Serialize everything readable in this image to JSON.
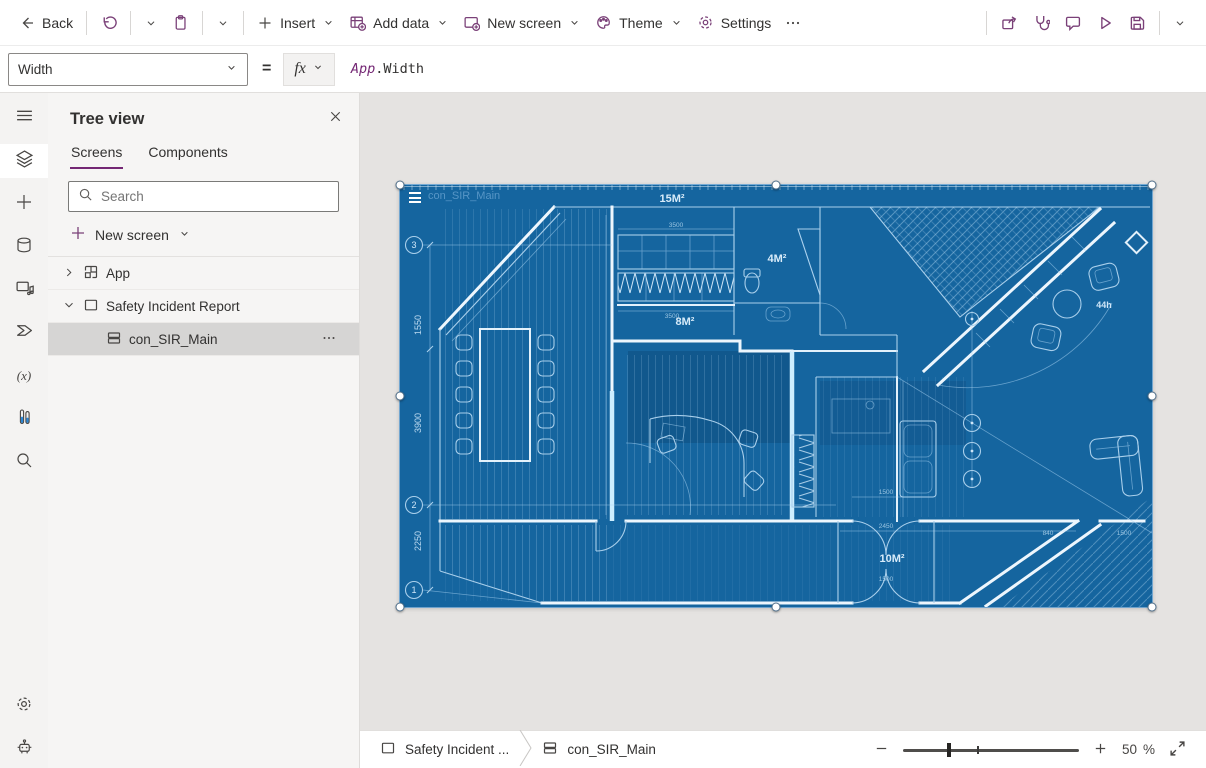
{
  "toolbar": {
    "back_label": "Back",
    "insert_label": "Insert",
    "add_data_label": "Add data",
    "new_screen_label": "New screen",
    "theme_label": "Theme",
    "settings_label": "Settings",
    "left_icons": [
      "back-arrow",
      "undo",
      "clipboard-paste",
      "insert-plus",
      "add-data",
      "new-screen",
      "theme-palette",
      "settings-gear",
      "more-ellipsis"
    ],
    "right_icons": [
      "share",
      "app-checker",
      "comments",
      "preview-play",
      "save",
      "save-options-chevron"
    ]
  },
  "formula_bar": {
    "property": "Width",
    "equals": "=",
    "fx_label": "fx",
    "formula": {
      "object": "App",
      "member": ".Width"
    }
  },
  "left_rail": {
    "icons": [
      "menu",
      "tree-view",
      "insert",
      "data",
      "media",
      "power-automate",
      "variables",
      "advanced-tools",
      "search",
      "settings",
      "virtual-agent"
    ],
    "variables_glyph": "(x)"
  },
  "tree_view": {
    "title": "Tree view",
    "tabs": {
      "screens": "Screens",
      "components": "Components"
    },
    "search_placeholder": "Search",
    "new_screen_label": "New screen",
    "items": {
      "app": "App",
      "screen": "Safety Incident Report",
      "container": "con_SIR_Main"
    }
  },
  "canvas": {
    "blueprint": {
      "title_overlay": "con_SIR_Main",
      "room_labels": [
        "15M²",
        "4M²",
        "8M²",
        "10M²",
        "44h"
      ],
      "grid_refs": [
        "3",
        "2",
        "1"
      ],
      "dims": [
        "1550",
        "3900",
        "2250"
      ],
      "small_dims": [
        "3500",
        "3500",
        "1500",
        "2450",
        "840",
        "1500",
        "1500"
      ]
    }
  },
  "status_bar": {
    "screen_tab": "Safety Incident ...",
    "container_tab": "con_SIR_Main",
    "zoom_value": "50",
    "zoom_unit": "%"
  },
  "colors": {
    "accent_purple": "#742774",
    "selection_blue": "#0078d4",
    "blueprint_bg": "#15659f"
  }
}
